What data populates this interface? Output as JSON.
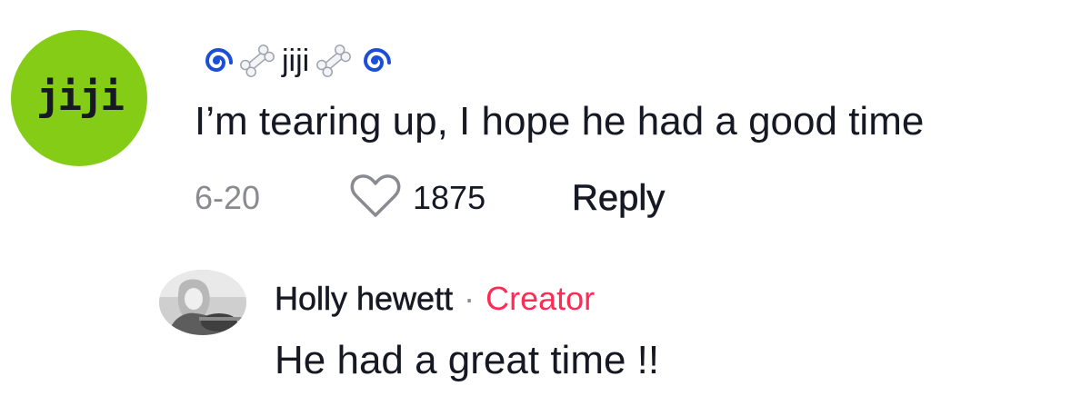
{
  "comment": {
    "avatar_text": "jiji",
    "avatar_color": "#84cc16",
    "username": "jiji",
    "username_decorations": [
      "spiral-emoji",
      "bone-emoji",
      "bone-emoji",
      "spiral-emoji"
    ],
    "text": "I’m tearing up, I hope he had a good time",
    "date": "6-20",
    "like_count": "1875",
    "reply_label": "Reply"
  },
  "reply": {
    "author": "Holly hewett",
    "separator": "·",
    "badge": "Creator",
    "badge_color": "#fe2c55",
    "text": "He had a great time !!"
  }
}
